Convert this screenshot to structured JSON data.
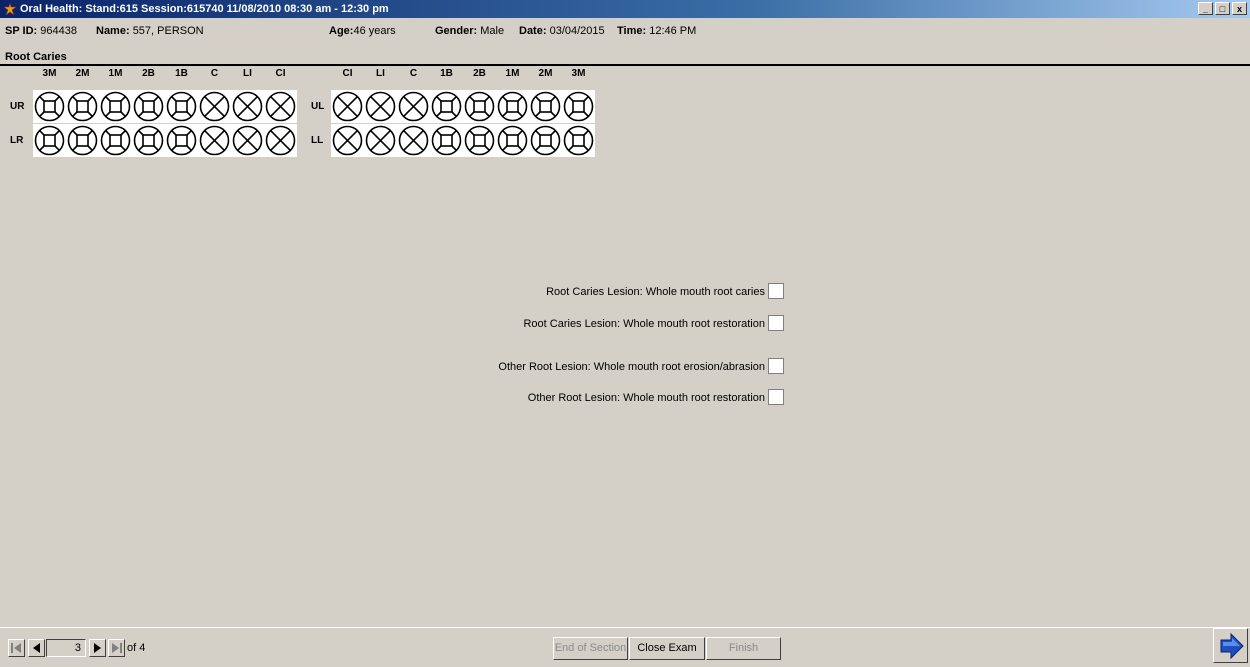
{
  "window": {
    "title": "Oral Health: Stand:615 Session:615740 11/08/2010 08:30 am - 12:30 pm",
    "buttons": [
      "_",
      "□",
      "x"
    ]
  },
  "info": {
    "sp_id_label": "SP ID:",
    "sp_id": "964438",
    "name_label": "Name:",
    "name": "557, PERSON",
    "age_label": "Age:",
    "age": "46 years",
    "gender_label": "Gender:",
    "gender": "Male",
    "date_label": "Date:",
    "date": "03/04/2015",
    "time_label": "Time:",
    "time": "12:46 PM"
  },
  "section": {
    "title": "Root Caries"
  },
  "teeth": {
    "right_headers": [
      "3M",
      "2M",
      "1M",
      "2B",
      "1B",
      "C",
      "LI",
      "CI"
    ],
    "left_headers": [
      "CI",
      "LI",
      "C",
      "1B",
      "2B",
      "1M",
      "2M",
      "3M"
    ],
    "right_types": [
      "grid",
      "grid",
      "grid",
      "grid",
      "grid",
      "x",
      "x",
      "x"
    ],
    "left_types": [
      "x",
      "x",
      "x",
      "grid",
      "grid",
      "grid",
      "grid",
      "grid"
    ],
    "row_labels": {
      "ur": "UR",
      "lr": "LR",
      "ul": "UL",
      "ll": "LL"
    }
  },
  "checkboxes": [
    {
      "label": "Root Caries Lesion: Whole mouth root caries",
      "checked": false
    },
    {
      "label": "Root Caries Lesion: Whole mouth root restoration",
      "checked": false
    },
    {
      "label": "Other Root Lesion: Whole mouth root erosion/abrasion",
      "checked": false
    },
    {
      "label": "Other Root Lesion: Whole mouth root restoration",
      "checked": false
    }
  ],
  "nav": {
    "page": "3",
    "of_label": "of 4"
  },
  "buttons": {
    "end_of_section": "End of Section",
    "close_exam": "Close Exam",
    "finish": "Finish"
  },
  "colors": {
    "title_gradient_start": "#0a246a",
    "background": "#d4d0c8",
    "next_arrow": "#1f4fbf"
  }
}
